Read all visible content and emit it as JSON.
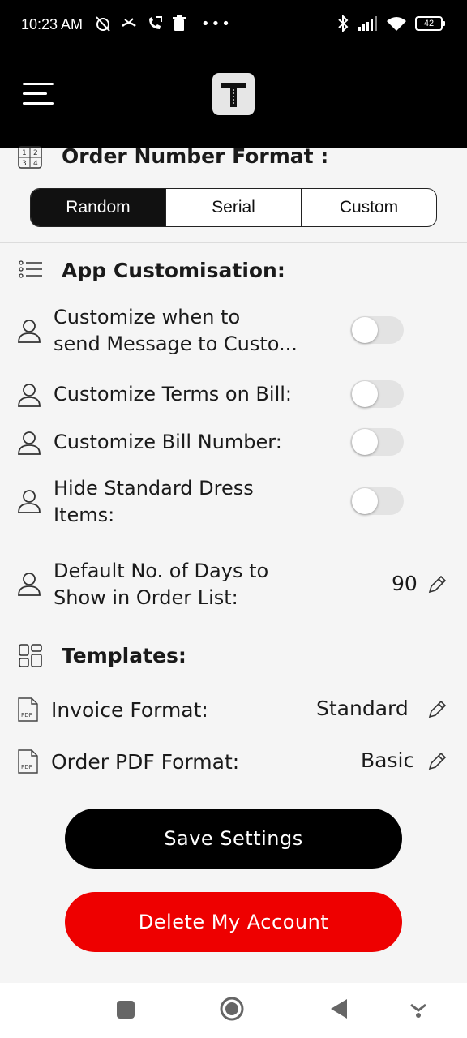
{
  "status_bar": {
    "time": "10:23 AM",
    "dots": "•••",
    "battery": "42"
  },
  "app_bar": {
    "menu_icon": "hamburger-menu-icon",
    "logo": "app-logo"
  },
  "order_number_format": {
    "title": "Order Number Format :",
    "options": [
      "Random",
      "Serial",
      "Custom"
    ],
    "selected": "Random"
  },
  "app_customisation": {
    "title": "App Customisation:",
    "items": [
      {
        "label_line1": "Customize when to",
        "label_line2": "send Message to Custo...",
        "enabled": false
      },
      {
        "label": "Customize Terms on Bill:",
        "enabled": false
      },
      {
        "label": "Customize Bill Number:",
        "enabled": false
      },
      {
        "label_line1": "Hide Standard Dress",
        "label_line2": "Items:",
        "enabled": false
      }
    ],
    "default_days": {
      "label_line1": "Default No. of Days to",
      "label_line2": "Show in Order List:",
      "value": "90"
    }
  },
  "templates": {
    "title": "Templates:",
    "invoice_format": {
      "label": "Invoice Format:",
      "value": "Standard"
    },
    "order_pdf_format": {
      "label": "Order PDF Format:",
      "value": "Basic"
    }
  },
  "buttons": {
    "save": "Save Settings",
    "delete": "Delete My Account"
  },
  "colors": {
    "delete_button": "#ee0000",
    "save_button": "#000000",
    "active_segment": "#111111"
  }
}
